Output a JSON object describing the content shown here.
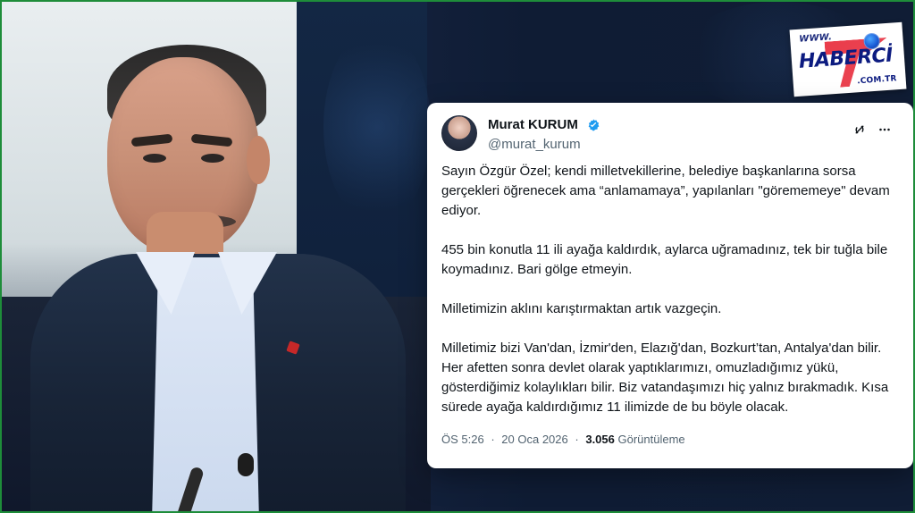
{
  "logo": {
    "www": "WWW.",
    "brand": "HABERCİ",
    "domain": ".COM.TR",
    "colors": {
      "navy": "#0c1b80",
      "red": "#e61b2c",
      "blue": "#1a5bd6"
    }
  },
  "tweet": {
    "author": {
      "display_name": "Murat KURUM",
      "handle": "@murat_kurum",
      "verified": true
    },
    "paragraphs": [
      "Sayın Özgür Özel; kendi milletvekillerine, belediye başkanlarına sorsa gerçekleri öğrenecek ama “anlamamaya”, yapılanları \"görememeye\" devam ediyor.",
      "455 bin konutla 11 ili ayağa kaldırdık, aylarca uğramadınız, tek bir tuğla bile koymadınız. Bari gölge etmeyin.",
      "Milletimizin aklını karıştırmaktan artık vazgeçin.",
      "Milletimiz bizi Van'dan, İzmir'den, Elazığ'dan, Bozkurt’tan, Antalya'dan bilir. Her afetten sonra devlet olarak yaptıklarımızı, omuzladığımız yükü, gösterdiğimiz kolaylıkları bilir. Biz vatandaşımızı hiç yalnız bırakmadık. Kısa sürede ayağa kaldırdığımız 11 ilimizde de bu böyle olacak."
    ],
    "meta": {
      "time": "ÖS 5:26",
      "date": "20 Oca 2026",
      "views": "3.056",
      "views_label": "Görüntüleme",
      "separator": "·"
    },
    "icons": {
      "grok": "grok-icon",
      "more": "more-icon",
      "verified": "verified-badge-icon"
    },
    "colors": {
      "verified": "#1d9bf0",
      "text": "#0f1419",
      "secondary": "#536471"
    }
  }
}
